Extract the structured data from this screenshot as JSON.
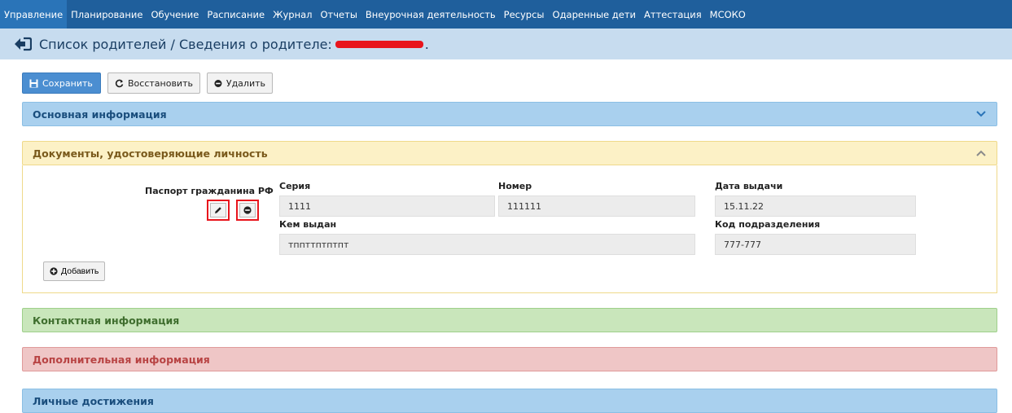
{
  "nav": {
    "items": [
      "Управление",
      "Планирование",
      "Обучение",
      "Расписание",
      "Журнал",
      "Отчеты",
      "Внеурочная деятельность",
      "Ресурсы",
      "Одаренные дети",
      "Аттестация",
      "МСОКО"
    ],
    "active_index": 0
  },
  "header": {
    "title": "Список родителей / Сведения о родителе:",
    "title_end": "."
  },
  "toolbar": {
    "save_label": "Сохранить",
    "restore_label": "Восстановить",
    "delete_label": "Удалить"
  },
  "sections": {
    "main_info": "Основная информация",
    "documents": "Документы, удостоверяющие личность",
    "contact_info": "Контактная информация",
    "extra_info": "Дополнительная информация",
    "achievements": "Личные достижения"
  },
  "document": {
    "type": "Паспорт гражданина РФ",
    "series_label": "Серия",
    "series_value": "1111",
    "number_label": "Номер",
    "number_value": "111111",
    "issue_date_label": "Дата выдачи",
    "issue_date_value": "15.11.22",
    "issued_by_label": "Кем выдан",
    "issued_by_value": "тппттптптпт",
    "dept_code_label": "Код подразделения",
    "dept_code_value": "777-777",
    "add_label": "Добавить"
  },
  "colors": {
    "nav_bg": "#1f5f9c",
    "title_bg": "#c7dcef",
    "highlight_red": "#e8151d"
  }
}
